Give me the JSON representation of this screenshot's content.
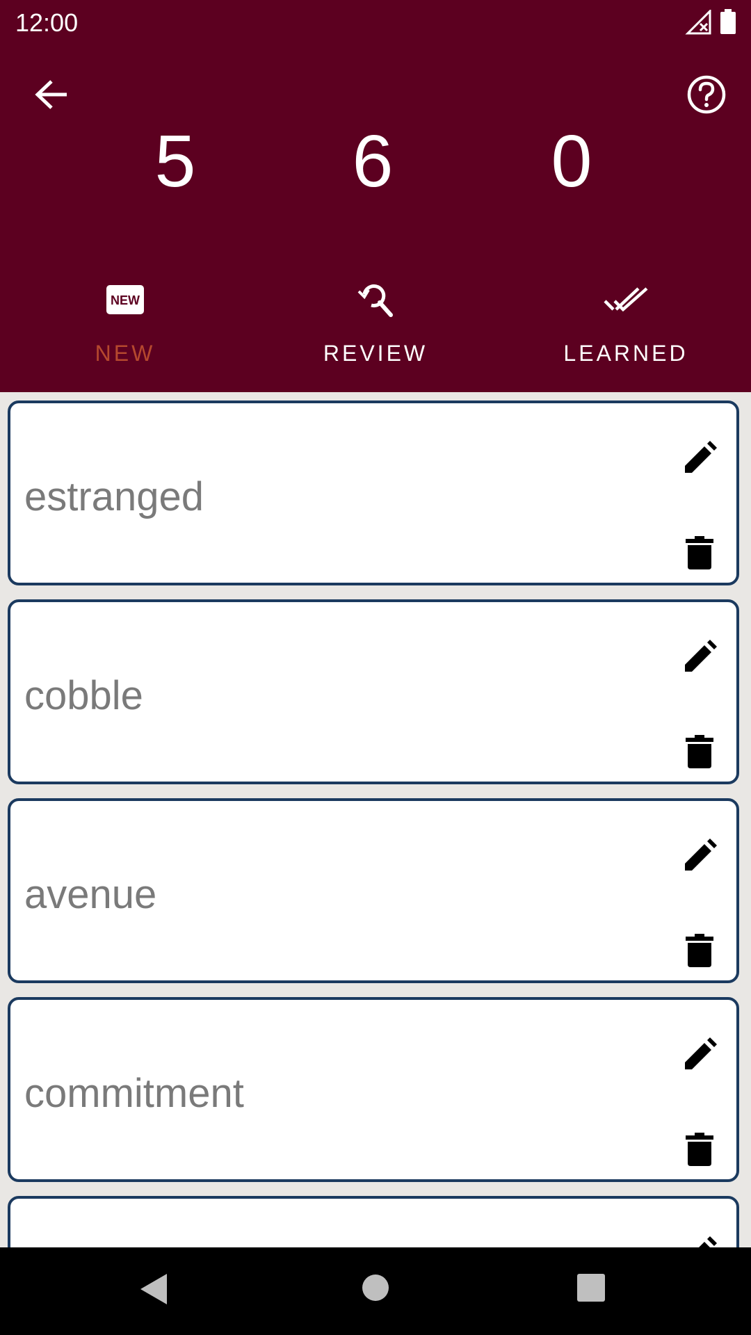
{
  "status_bar": {
    "time": "12:00"
  },
  "header": {
    "counts": {
      "new": "5",
      "review": "6",
      "learned": "0"
    },
    "tabs": [
      {
        "label": "NEW",
        "icon": "new-badge-icon",
        "active": true
      },
      {
        "label": "REVIEW",
        "icon": "search-refresh-icon",
        "active": false
      },
      {
        "label": "LEARNED",
        "icon": "double-check-icon",
        "active": false
      }
    ]
  },
  "words": [
    {
      "word": "estranged"
    },
    {
      "word": "cobble"
    },
    {
      "word": "avenue"
    },
    {
      "word": "commitment"
    },
    {
      "word": ""
    }
  ],
  "colors": {
    "header_bg": "#5c0020",
    "active_tab": "#b5482e",
    "card_border": "#1b3a5f",
    "word_text": "#7a7a7a"
  }
}
